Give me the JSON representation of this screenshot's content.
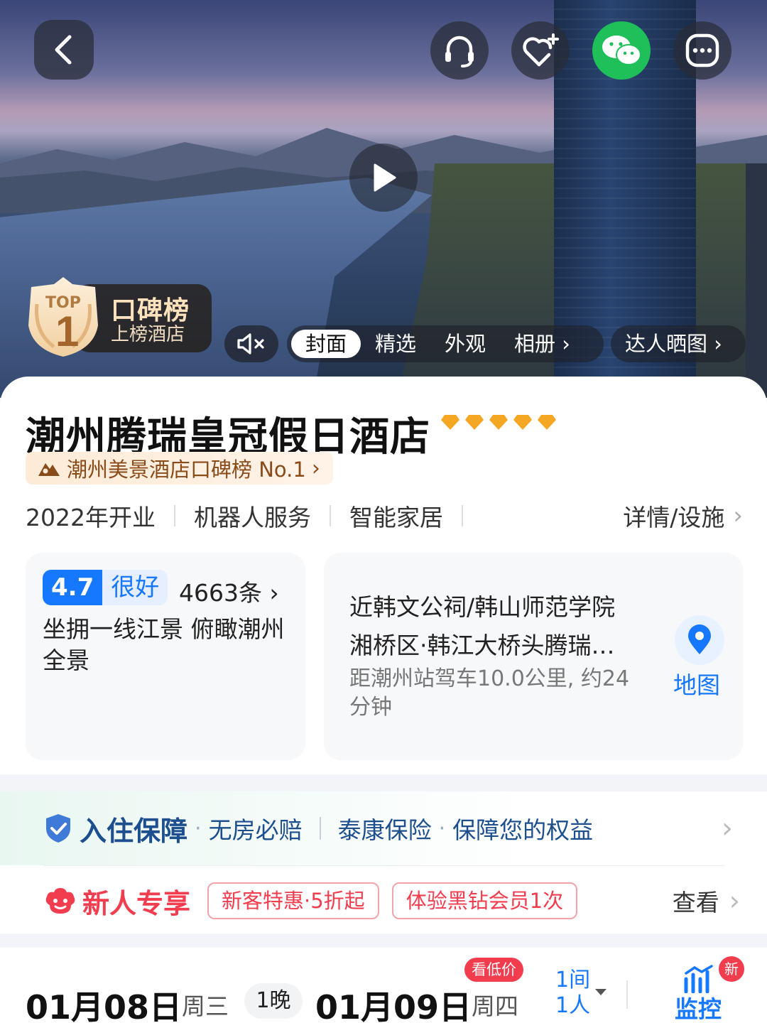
{
  "hero": {
    "top_badge": {
      "top_word": "TOP",
      "rank_number": "1",
      "title": "口碑榜",
      "subtitle": "上榜酒店"
    },
    "media_tabs": [
      {
        "label": "封面",
        "active": true,
        "more": false
      },
      {
        "label": "精选",
        "active": false,
        "more": false
      },
      {
        "label": "外观",
        "active": false,
        "more": false
      },
      {
        "label": "相册",
        "active": false,
        "more": true
      }
    ],
    "expert_tab": "达人晒图 ›",
    "icons": [
      "back-icon",
      "headset-icon",
      "favorite-icon",
      "wechat-icon",
      "more-icon",
      "play-icon",
      "mute-icon"
    ]
  },
  "hotel": {
    "name": "潮州腾瑞皇冠假日酒店",
    "diamond_count": 5,
    "rank_text": "潮州美景酒店口碑榜 No.1",
    "tags": [
      "2022年开业",
      "机器人服务",
      "智能家居"
    ],
    "details_link": "详情/设施"
  },
  "review": {
    "score": "4.7",
    "level": "很好",
    "count": "4663条 ›",
    "quote": "坐拥一线江景 俯瞰潮州全景"
  },
  "location": {
    "landmark": "近韩文公祠/韩山师范学院",
    "address": "湘桥区·韩江大桥头腾瑞…",
    "distance": "距潮州站驾车10.0公里, 约24分钟",
    "map_label": "地图"
  },
  "guarantee": {
    "title": "入住保障",
    "item1": "无房必赔",
    "item2": "泰康保险",
    "item3": "保障您的权益"
  },
  "newuser": {
    "title": "新人专享",
    "coupons": [
      "新客特惠·5折起",
      "体验黑钻会员1次"
    ],
    "view_label": "查看"
  },
  "dates": {
    "checkin": "01月08日",
    "checkin_week": "周三",
    "nights": "1晚",
    "checkout": "01月09日",
    "checkout_week": "周四",
    "low_price_tag": "看低价",
    "rooms": "1间",
    "guests": "1人",
    "monitor_label": "监控",
    "new_badge": "新"
  },
  "colors": {
    "accent_blue": "#1677ff",
    "promo_red": "#f23d4f",
    "wechat_green": "#1fc05a",
    "gold": "#f5a623"
  }
}
